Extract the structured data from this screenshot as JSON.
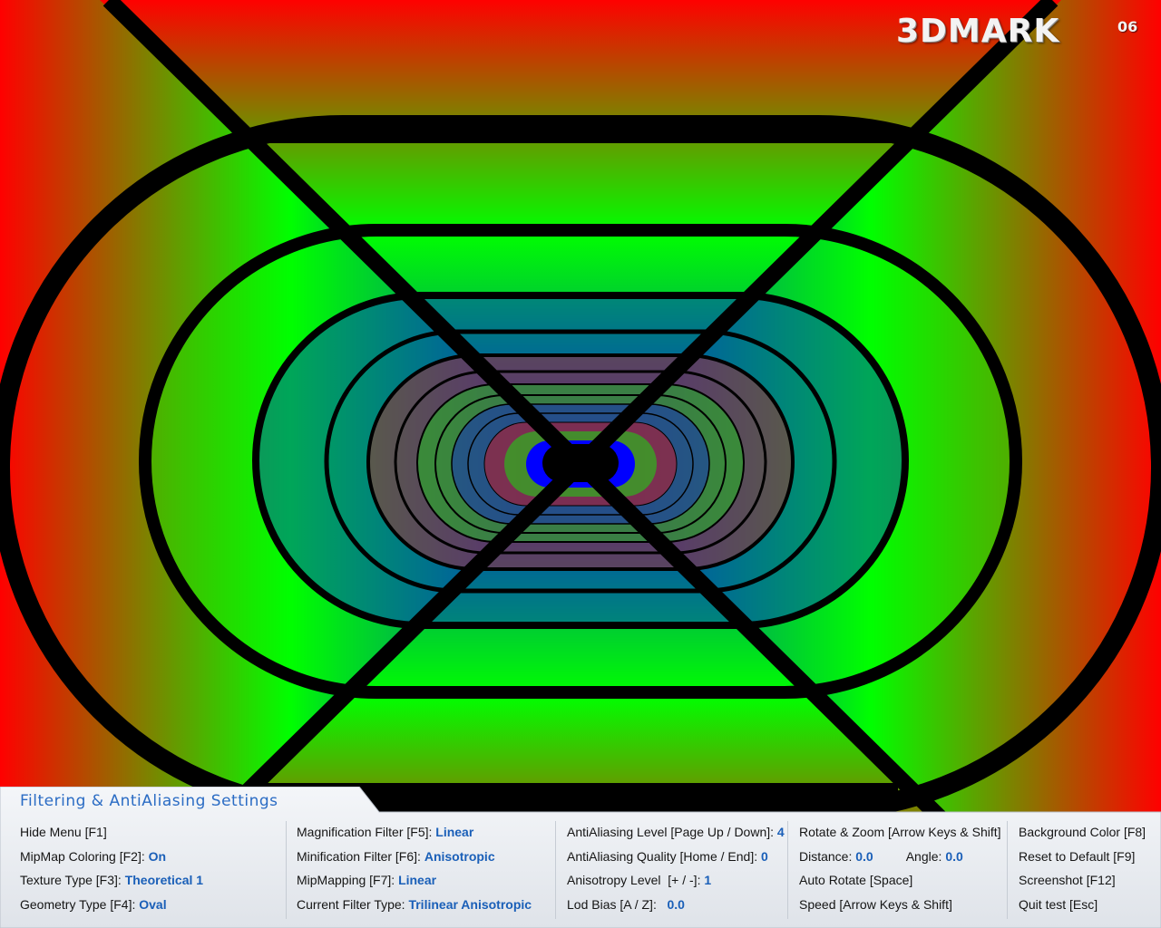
{
  "app": {
    "logo_text": "3DMARK",
    "logo_suffix": "06"
  },
  "panel": {
    "title": "Filtering & AntiAliasing Settings",
    "col1": {
      "hide_menu": "Hide Menu [F1]",
      "mipmap_coloring_label": "MipMap Coloring [F2]:",
      "mipmap_coloring_value": "On",
      "texture_type_label": "Texture Type [F3]:",
      "texture_type_value": "Theoretical 1",
      "geometry_type_label": "Geometry Type [F4]:",
      "geometry_type_value": "Oval"
    },
    "col2": {
      "mag_filter_label": "Magnification Filter [F5]:",
      "mag_filter_value": "Linear",
      "min_filter_label": "Minification Filter [F6]:",
      "min_filter_value": "Anisotropic",
      "mipmapping_label": "MipMapping [F7]:",
      "mipmapping_value": "Linear",
      "current_filter_label": "Current Filter Type:",
      "current_filter_value": "Trilinear Anisotropic"
    },
    "col3": {
      "aa_level_label": "AntiAliasing Level [Page Up / Down]:",
      "aa_level_value": "4",
      "aa_quality_label": "AntiAliasing Quality [Home / End]:",
      "aa_quality_value": "0",
      "aniso_level_label": "Anisotropy Level  [+ / -]:",
      "aniso_level_value": "1",
      "lod_bias_label": "Lod Bias [A / Z]:",
      "lod_bias_value": "0.0"
    },
    "col4": {
      "rotate_zoom": "Rotate & Zoom [Arrow Keys & Shift]",
      "distance_label": "Distance:",
      "distance_value": "0.0",
      "angle_label": "Angle:",
      "angle_value": "0.0",
      "auto_rotate": "Auto Rotate [Space]",
      "speed": "Speed [Arrow Keys & Shift]"
    },
    "col5": {
      "background_color": "Background Color [F8]",
      "reset_default": "Reset to Default [F9]",
      "screenshot": "Screenshot [F12]",
      "quit_test": "Quit test [Esc]"
    }
  },
  "colors": {
    "red": "#ff0000",
    "green": "#00ff00",
    "blue": "#0000ff",
    "value_text": "#1a5fb8",
    "title_text": "#2b6cc4"
  }
}
